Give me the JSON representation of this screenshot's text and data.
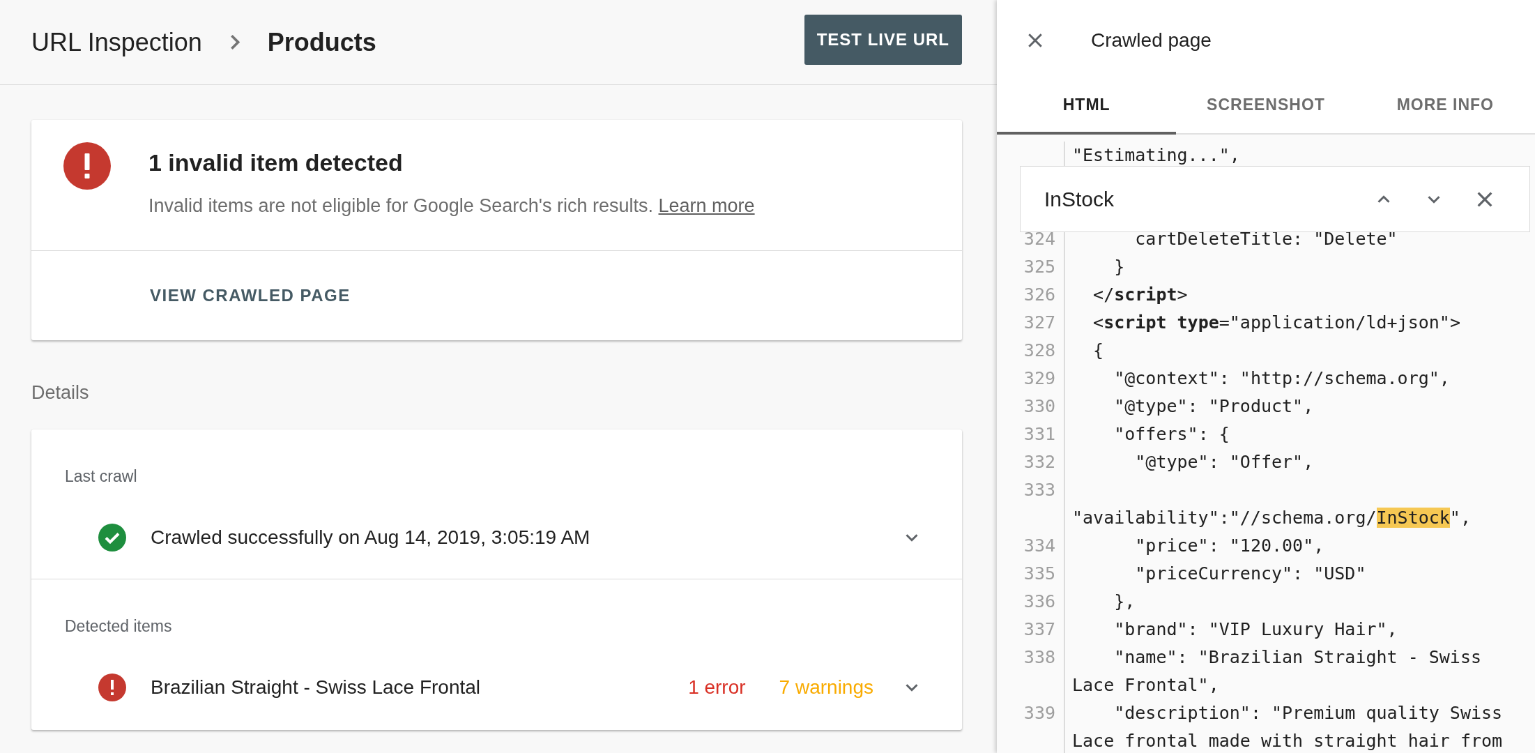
{
  "header": {
    "breadcrumb": [
      "URL Inspection",
      "Products"
    ],
    "button": "TEST LIVE URL"
  },
  "status_card": {
    "kind": "error",
    "title": "1 invalid item detected",
    "description": "Invalid items are not eligible for Google Search's rich results.",
    "link": "Learn more",
    "action": "VIEW CRAWLED PAGE"
  },
  "details_label": "Details",
  "details": {
    "last_crawl": {
      "label": "Last crawl",
      "kind": "success",
      "text": "Crawled successfully on Aug 14, 2019, 3:05:19 AM",
      "expanded": false
    },
    "detected_items": {
      "label": "Detected items",
      "items": [
        {
          "kind": "error",
          "name": "Brazilian Straight - Swiss Lace Frontal",
          "errors": "1 error",
          "warnings": "7 warnings",
          "expanded": false
        }
      ]
    }
  },
  "panel": {
    "title": "Crawled page",
    "tabs": [
      {
        "label": "HTML",
        "selected": true
      },
      {
        "label": "SCREENSHOT",
        "selected": false
      },
      {
        "label": "MORE INFO",
        "selected": false
      }
    ],
    "search": {
      "value": "InStock"
    },
    "code": {
      "continued": "\"Estimating...\",",
      "lines": [
        {
          "number": "324",
          "parts": [
            {
              "kind": "text",
              "text": "      cartDeleteTitle: \"Delete\""
            }
          ]
        },
        {
          "number": "325",
          "parts": [
            {
              "kind": "text",
              "text": "    }"
            }
          ]
        },
        {
          "number": "326",
          "parts": [
            {
              "kind": "text",
              "text": "  </"
            },
            {
              "kind": "tag",
              "text": "script"
            },
            {
              "kind": "text",
              "text": ">"
            }
          ]
        },
        {
          "number": "327",
          "parts": [
            {
              "kind": "text",
              "text": "  <"
            },
            {
              "kind": "tag",
              "text": "script "
            },
            {
              "kind": "tag",
              "text": "type"
            },
            {
              "kind": "text",
              "text": "=\"application/ld+json\">"
            }
          ]
        },
        {
          "number": "328",
          "parts": [
            {
              "kind": "text",
              "text": "  {"
            }
          ]
        },
        {
          "number": "329",
          "parts": [
            {
              "kind": "text",
              "text": "    \"@context\": \"http://schema.org\","
            }
          ]
        },
        {
          "number": "330",
          "parts": [
            {
              "kind": "text",
              "text": "    \"@type\": \"Product\","
            }
          ]
        },
        {
          "number": "331",
          "parts": [
            {
              "kind": "text",
              "text": "    \"offers\": {"
            }
          ]
        },
        {
          "number": "332",
          "parts": [
            {
              "kind": "text",
              "text": "      \"@type\": \"Offer\","
            }
          ]
        },
        {
          "number": "333",
          "parts": [
            {
              "kind": "text",
              "text": "       \"availability\":\"//schema.org/"
            },
            {
              "kind": "match",
              "text": "InStock"
            },
            {
              "kind": "text",
              "text": "\","
            }
          ]
        },
        {
          "number": "334",
          "parts": [
            {
              "kind": "text",
              "text": "      \"price\": \"120.00\","
            }
          ]
        },
        {
          "number": "335",
          "parts": [
            {
              "kind": "text",
              "text": "      \"priceCurrency\": \"USD\""
            }
          ]
        },
        {
          "number": "336",
          "parts": [
            {
              "kind": "text",
              "text": "    },"
            }
          ]
        },
        {
          "number": "337",
          "parts": [
            {
              "kind": "text",
              "text": "    \"brand\": \"VIP Luxury Hair\","
            }
          ]
        },
        {
          "number": "338",
          "parts": [
            {
              "kind": "text",
              "text": "    \"name\": \"Brazilian Straight - Swiss Lace Frontal\","
            }
          ]
        },
        {
          "number": "339",
          "parts": [
            {
              "kind": "text",
              "text": "    \"description\": \"Premium quality Swiss Lace frontal made with straight hair from"
            }
          ]
        }
      ]
    }
  }
}
